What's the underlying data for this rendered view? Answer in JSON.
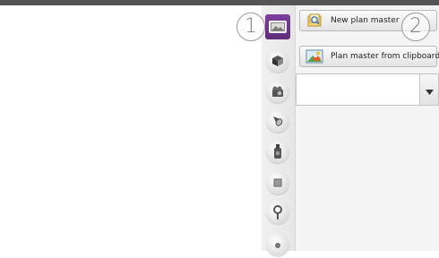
{
  "buttons": {
    "new_plan_master": "New plan master",
    "plan_master_from_clipboard": "Plan master from clipboard"
  },
  "callouts": [
    "1",
    "2"
  ],
  "tabs": [
    {
      "icon": "plan-image-icon",
      "active": true
    },
    {
      "icon": "cube-icon",
      "active": false
    },
    {
      "icon": "camera-icon",
      "active": false
    },
    {
      "icon": "spotlight-icon",
      "active": false
    },
    {
      "icon": "bottle-icon",
      "active": false
    },
    {
      "icon": "square-icon",
      "active": false
    },
    {
      "icon": "pin-icon",
      "active": false
    },
    {
      "icon": "partial-icon",
      "active": false
    }
  ],
  "colors": {
    "active_tab": "#6b3189",
    "top_bar": "#555555"
  }
}
